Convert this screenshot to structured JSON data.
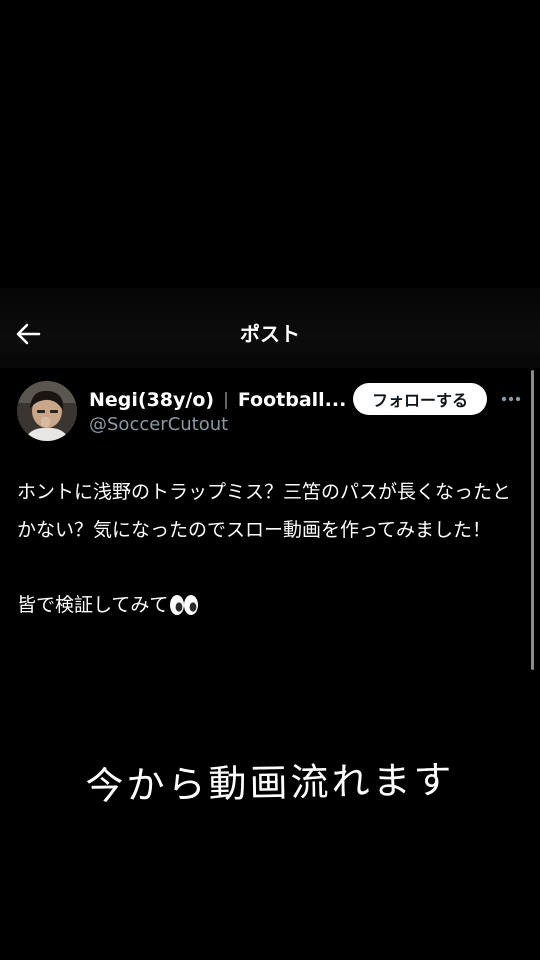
{
  "header": {
    "title": "ポスト",
    "back_icon": "arrow-left-icon"
  },
  "author": {
    "name": "Negi(38y/o)",
    "separator": "|",
    "bio_snippet": "Football...",
    "handle": "@SoccerCutout",
    "avatar_icon": "user-avatar"
  },
  "actions": {
    "follow_label": "フォローする",
    "more_icon": "more-horizontal-icon"
  },
  "post": {
    "text": "ホントに浅野のトラップミス？三笘のパスが長くなったとかない？気になったのでスロー動画を作ってみました！\n\n皆で検証してみて",
    "emoji_icon": "eyes-emoji-icon"
  },
  "overlay": {
    "caption": "今から動画流れます"
  },
  "colors": {
    "background": "#000000",
    "text": "#ffffff",
    "muted": "#8b98a5",
    "button_bg": "#ffffff",
    "button_text": "#0f1419"
  }
}
